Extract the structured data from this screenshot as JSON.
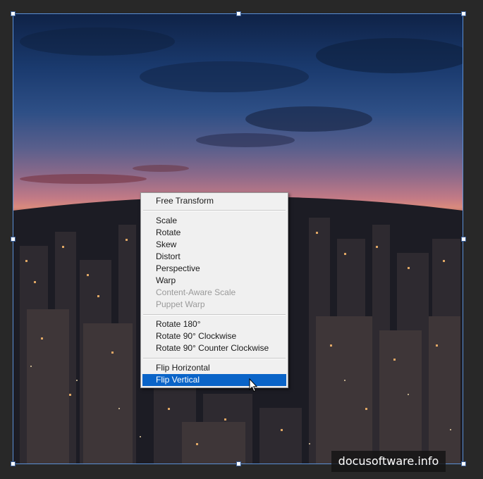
{
  "context_menu": {
    "items": [
      {
        "label": "Free Transform",
        "enabled": true
      },
      {
        "label": "Scale",
        "enabled": true
      },
      {
        "label": "Rotate",
        "enabled": true
      },
      {
        "label": "Skew",
        "enabled": true
      },
      {
        "label": "Distort",
        "enabled": true
      },
      {
        "label": "Perspective",
        "enabled": true
      },
      {
        "label": "Warp",
        "enabled": true
      },
      {
        "label": "Content-Aware Scale",
        "enabled": false
      },
      {
        "label": "Puppet Warp",
        "enabled": false
      },
      {
        "label": "Rotate 180°",
        "enabled": true
      },
      {
        "label": "Rotate 90° Clockwise",
        "enabled": true
      },
      {
        "label": "Rotate 90° Counter Clockwise",
        "enabled": true
      },
      {
        "label": "Flip Horizontal",
        "enabled": true
      },
      {
        "label": "Flip Vertical",
        "enabled": true,
        "highlighted": true
      }
    ]
  },
  "watermark": "docusoftware.info",
  "colors": {
    "menu_highlight": "#0a64c8",
    "bounding_box": "#5a8fd6",
    "workspace_bg": "#282828"
  },
  "icons": {
    "cursor": "arrow-pointer-icon"
  }
}
